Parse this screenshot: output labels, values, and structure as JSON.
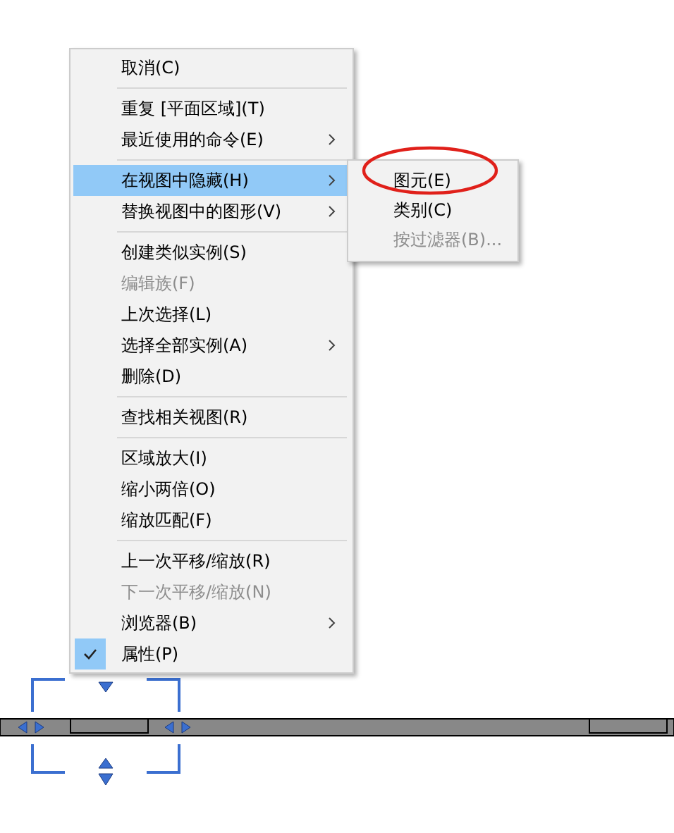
{
  "context_menu": {
    "items": [
      {
        "kind": "item",
        "label": "取消(C)",
        "disabled": false,
        "submenu": false,
        "selected": false,
        "checked": false
      },
      {
        "kind": "separator"
      },
      {
        "kind": "item",
        "label": "重复 [平面区域](T)",
        "disabled": false,
        "submenu": false,
        "selected": false,
        "checked": false
      },
      {
        "kind": "item",
        "label": "最近使用的命令(E)",
        "disabled": false,
        "submenu": true,
        "selected": false,
        "checked": false
      },
      {
        "kind": "separator"
      },
      {
        "kind": "item",
        "label": "在视图中隐藏(H)",
        "disabled": false,
        "submenu": true,
        "selected": true,
        "checked": false
      },
      {
        "kind": "item",
        "label": "替换视图中的图形(V)",
        "disabled": false,
        "submenu": true,
        "selected": false,
        "checked": false
      },
      {
        "kind": "separator"
      },
      {
        "kind": "item",
        "label": "创建类似实例(S)",
        "disabled": false,
        "submenu": false,
        "selected": false,
        "checked": false
      },
      {
        "kind": "item",
        "label": "编辑族(F)",
        "disabled": true,
        "submenu": false,
        "selected": false,
        "checked": false
      },
      {
        "kind": "item",
        "label": "上次选择(L)",
        "disabled": false,
        "submenu": false,
        "selected": false,
        "checked": false
      },
      {
        "kind": "item",
        "label": "选择全部实例(A)",
        "disabled": false,
        "submenu": true,
        "selected": false,
        "checked": false
      },
      {
        "kind": "item",
        "label": "删除(D)",
        "disabled": false,
        "submenu": false,
        "selected": false,
        "checked": false
      },
      {
        "kind": "separator"
      },
      {
        "kind": "item",
        "label": "查找相关视图(R)",
        "disabled": false,
        "submenu": false,
        "selected": false,
        "checked": false
      },
      {
        "kind": "separator"
      },
      {
        "kind": "item",
        "label": "区域放大(I)",
        "disabled": false,
        "submenu": false,
        "selected": false,
        "checked": false
      },
      {
        "kind": "item",
        "label": "缩小两倍(O)",
        "disabled": false,
        "submenu": false,
        "selected": false,
        "checked": false
      },
      {
        "kind": "item",
        "label": "缩放匹配(F)",
        "disabled": false,
        "submenu": false,
        "selected": false,
        "checked": false
      },
      {
        "kind": "separator"
      },
      {
        "kind": "item",
        "label": "上一次平移/缩放(R)",
        "disabled": false,
        "submenu": false,
        "selected": false,
        "checked": false
      },
      {
        "kind": "item",
        "label": "下一次平移/缩放(N)",
        "disabled": true,
        "submenu": false,
        "selected": false,
        "checked": false
      },
      {
        "kind": "item",
        "label": "浏览器(B)",
        "disabled": false,
        "submenu": true,
        "selected": false,
        "checked": false
      },
      {
        "kind": "item",
        "label": "属性(P)",
        "disabled": false,
        "submenu": false,
        "selected": false,
        "checked": true
      }
    ]
  },
  "submenu": {
    "items": [
      {
        "label": "图元(E)",
        "disabled": false,
        "circled": true
      },
      {
        "label": "类别(C)",
        "disabled": false,
        "circled": false
      },
      {
        "label": "按过滤器(B)...",
        "disabled": true,
        "circled": false
      }
    ]
  }
}
